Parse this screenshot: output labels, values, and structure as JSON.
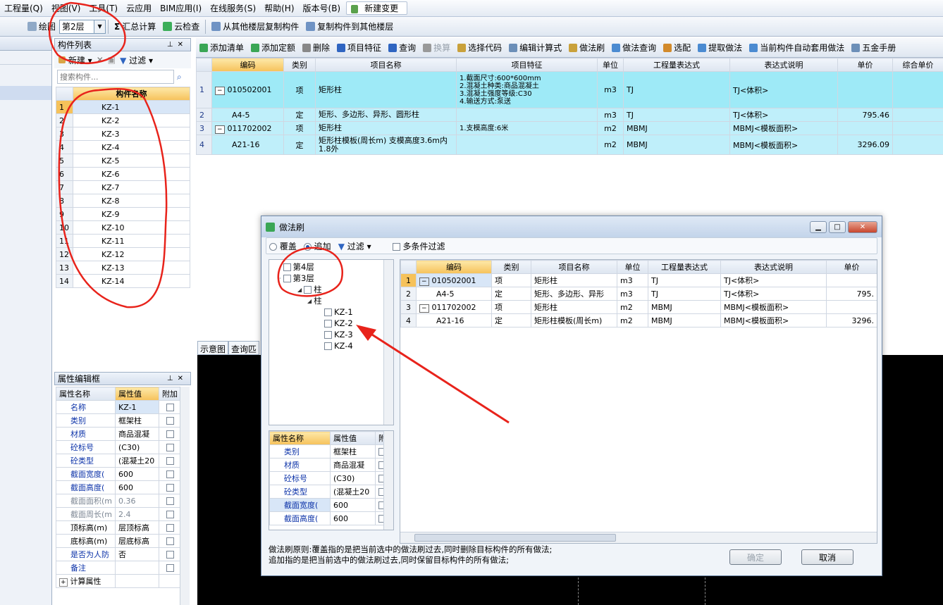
{
  "menu": [
    "工程量(Q)",
    "视图(V)",
    "工具(T)",
    "云应用",
    "BIM应用(I)",
    "在线服务(S)",
    "帮助(H)",
    "版本号(B)",
    "新建变更"
  ],
  "toolbar": {
    "draw": "绘图",
    "floor": "第2层",
    "sum": "汇总计算",
    "cloud_check": "云检查",
    "copy_from": "从其他楼层复制构件",
    "copy_to": "复制构件到其他楼层"
  },
  "comp_list": {
    "title": "构件列表",
    "new_btn": "新建",
    "filter_btn": "过滤",
    "search_placeholder": "搜索构件...",
    "col_header": "构件名称",
    "rows": [
      {
        "no": "1",
        "name": "KZ-1"
      },
      {
        "no": "2",
        "name": "KZ-2"
      },
      {
        "no": "3",
        "name": "KZ-3"
      },
      {
        "no": "4",
        "name": "KZ-4"
      },
      {
        "no": "5",
        "name": "KZ-5"
      },
      {
        "no": "6",
        "name": "KZ-6"
      },
      {
        "no": "7",
        "name": "KZ-7"
      },
      {
        "no": "8",
        "name": "KZ-8"
      },
      {
        "no": "9",
        "name": "KZ-9"
      },
      {
        "no": "10",
        "name": "KZ-10"
      },
      {
        "no": "11",
        "name": "KZ-11"
      },
      {
        "no": "12",
        "name": "KZ-12"
      },
      {
        "no": "13",
        "name": "KZ-13"
      },
      {
        "no": "14",
        "name": "KZ-14"
      }
    ]
  },
  "main_toolbar": [
    "添加清单",
    "添加定额",
    "删除",
    "项目特征",
    "查询",
    "换算",
    "选择代码",
    "编辑计算式",
    "做法刷",
    "做法查询",
    "选配",
    "提取做法",
    "当前构件自动套用做法",
    "五金手册"
  ],
  "main_table": {
    "headers": [
      "编码",
      "类别",
      "项目名称",
      "项目特征",
      "单位",
      "工程量表达式",
      "表达式说明",
      "单价",
      "综合单价"
    ],
    "rows": [
      {
        "no": "1",
        "code": "010502001",
        "cat": "项",
        "name": "矩形柱",
        "feature": [
          "1.截面尺寸:600*600mm",
          "2.混凝土种类:商品混凝土",
          "3.混凝土强度等级:C30",
          "4.输送方式:泵送"
        ],
        "unit": "m3",
        "expr": "TJ",
        "desc": "TJ<体积>",
        "price": "",
        "comp": ""
      },
      {
        "no": "2",
        "code": "A4-5",
        "cat": "定",
        "name": "矩形、多边形、异形、圆形柱",
        "feature": [],
        "unit": "m3",
        "expr": "TJ",
        "desc": "TJ<体积>",
        "price": "795.46",
        "comp": ""
      },
      {
        "no": "3",
        "code": "011702002",
        "cat": "项",
        "name": "矩形柱",
        "feature": [
          "1.支模高度:6米"
        ],
        "unit": "m2",
        "expr": "MBMJ",
        "desc": "MBMJ<模板面积>",
        "price": "",
        "comp": ""
      },
      {
        "no": "4",
        "code": "A21-16",
        "cat": "定",
        "name": "矩形柱模板(周长m) 支模高度3.6m内 1.8外",
        "feature": [],
        "unit": "m2",
        "expr": "MBMJ",
        "desc": "MBMJ<模板面积>",
        "price": "3296.09",
        "comp": ""
      }
    ]
  },
  "tabs": [
    "示意图",
    "查询匹"
  ],
  "props": {
    "title": "属性编辑框",
    "headers": [
      "属性名称",
      "属性值",
      "附加"
    ],
    "rows": [
      {
        "k": "名称",
        "v": "KZ-1",
        "style": "blue"
      },
      {
        "k": "类别",
        "v": "框架柱",
        "style": "blue"
      },
      {
        "k": "材质",
        "v": "商品混凝",
        "style": "blue"
      },
      {
        "k": "砼标号",
        "v": "(C30)",
        "style": "blue"
      },
      {
        "k": "砼类型",
        "v": "(混凝土20",
        "style": "blue"
      },
      {
        "k": "截面宽度(",
        "v": "600",
        "style": "blue"
      },
      {
        "k": "截面高度(",
        "v": "600",
        "style": "blue"
      },
      {
        "k": "截面面积(m",
        "v": "0.36",
        "style": "grey"
      },
      {
        "k": "截面周长(m",
        "v": "2.4",
        "style": "grey"
      },
      {
        "k": "顶标高(m)",
        "v": "层顶标高",
        "style": ""
      },
      {
        "k": "底标高(m)",
        "v": "层底标高",
        "style": ""
      },
      {
        "k": "是否为人防",
        "v": "否",
        "style": "blue"
      },
      {
        "k": "备注",
        "v": "",
        "style": "blue"
      },
      {
        "k": "计算属性",
        "v": "",
        "style": ""
      }
    ]
  },
  "dialog": {
    "title": "做法刷",
    "overwrite": "覆盖",
    "append": "追加",
    "filter": "过滤",
    "multi_filter": "多条件过滤",
    "tree": [
      "第4层",
      "第3层",
      "柱",
      "柱",
      "KZ-1",
      "KZ-2",
      "KZ-3",
      "KZ-4"
    ],
    "table_headers": [
      "编码",
      "类别",
      "项目名称",
      "单位",
      "工程量表达式",
      "表达式说明",
      "单价"
    ],
    "rows": [
      {
        "no": "1",
        "code": "010502001",
        "cat": "项",
        "name": "矩形柱",
        "unit": "m3",
        "expr": "TJ",
        "desc": "TJ<体积>",
        "price": ""
      },
      {
        "no": "2",
        "code": "A4-5",
        "cat": "定",
        "name": "矩形、多边形、异形",
        "unit": "m3",
        "expr": "TJ",
        "desc": "TJ<体积>",
        "price": "795."
      },
      {
        "no": "3",
        "code": "011702002",
        "cat": "项",
        "name": "矩形柱",
        "unit": "m2",
        "expr": "MBMJ",
        "desc": "MBMJ<模板面积>",
        "price": ""
      },
      {
        "no": "4",
        "code": "A21-16",
        "cat": "定",
        "name": "矩形柱模板(周长m)",
        "unit": "m2",
        "expr": "MBMJ",
        "desc": "MBMJ<模板面积>",
        "price": "3296."
      }
    ],
    "prop_headers": [
      "属性名称",
      "属性值",
      "附"
    ],
    "props": [
      {
        "k": "类别",
        "v": "框架柱"
      },
      {
        "k": "材质",
        "v": "商品混凝"
      },
      {
        "k": "砼标号",
        "v": "(C30)"
      },
      {
        "k": "砼类型",
        "v": "(混凝土20"
      },
      {
        "k": "截面宽度(",
        "v": "600"
      },
      {
        "k": "截面高度(",
        "v": "600"
      }
    ],
    "rule_line1": "做法刷原则:覆盖指的是把当前选中的做法刷过去,同时删除目标构件的所有做法;",
    "rule_line2": "追加指的是把当前选中的做法刷过去,同时保留目标构件的所有做法;",
    "ok": "确定",
    "cancel": "取消"
  },
  "colors": {
    "accent_cyan": "#9eeaf7",
    "header_orange": "#f6c25a",
    "annotation_red": "#e8231b"
  }
}
